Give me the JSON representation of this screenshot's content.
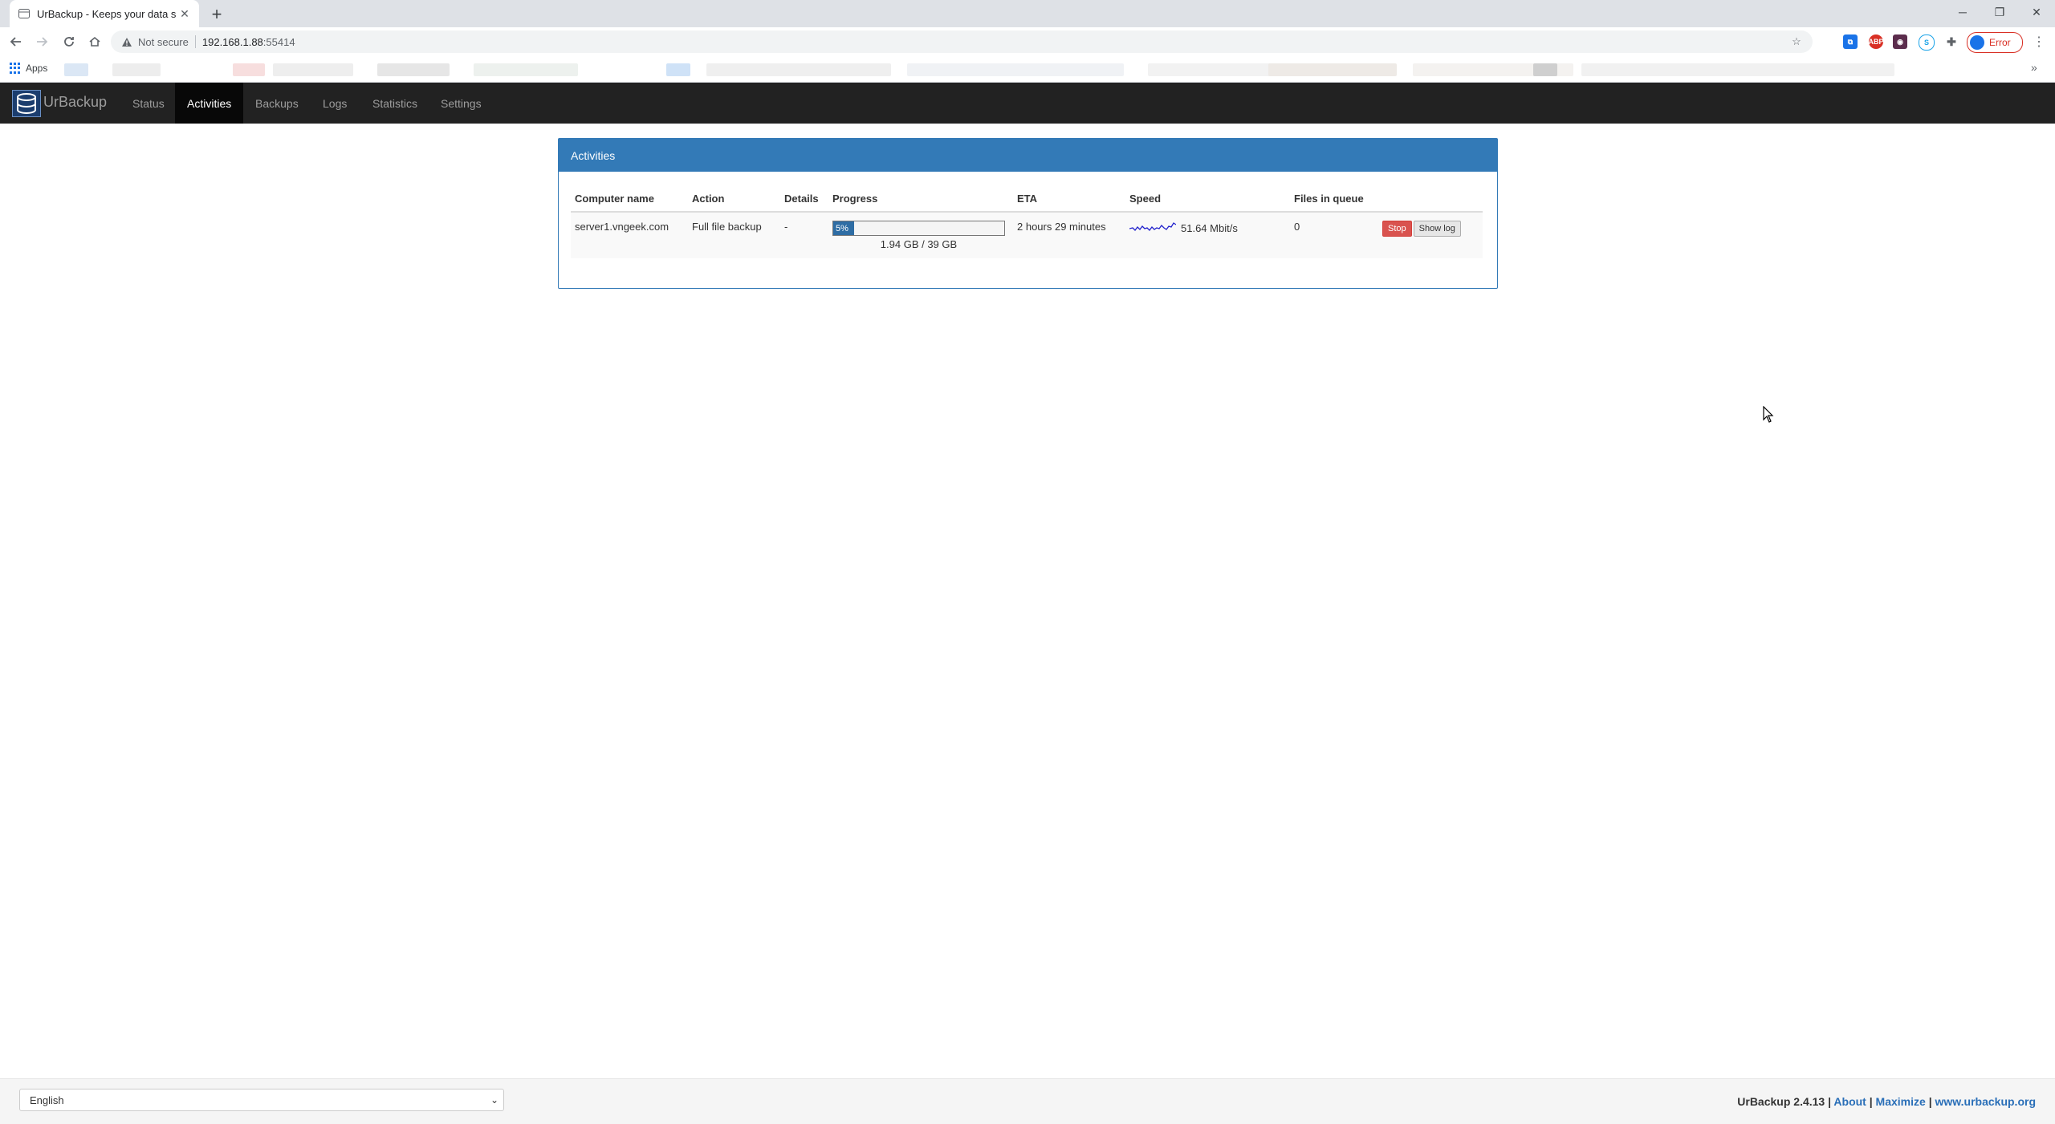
{
  "browser": {
    "tab_title": "UrBackup - Keeps your data safe",
    "new_tab_label": "+",
    "not_secure_label": "Not secure",
    "url_host": "192.168.1.88",
    "url_port": ":55414",
    "profile_label": "Error",
    "bookmarks_apps_label": "Apps"
  },
  "app": {
    "brand": "UrBackup",
    "nav": [
      {
        "label": "Status",
        "active": false
      },
      {
        "label": "Activities",
        "active": true
      },
      {
        "label": "Backups",
        "active": false
      },
      {
        "label": "Logs",
        "active": false
      },
      {
        "label": "Statistics",
        "active": false
      },
      {
        "label": "Settings",
        "active": false
      }
    ]
  },
  "activities": {
    "title": "Activities",
    "columns": [
      "Computer name",
      "Action",
      "Details",
      "Progress",
      "ETA",
      "Speed",
      "Files in queue"
    ],
    "rows": [
      {
        "computer_name": "server1.vngeek.com",
        "action": "Full file backup",
        "details": "-",
        "progress_percent": 5,
        "progress_label": "5%",
        "progress_size": "1.94 GB / 39 GB",
        "eta": "2 hours 29 minutes",
        "speed": "51.64 Mbit/s",
        "files_in_queue": "0",
        "stop_label": "Stop",
        "show_log_label": "Show log"
      }
    ]
  },
  "footer": {
    "language": "English",
    "version": "UrBackup 2.4.13",
    "sep": "|",
    "about": "About",
    "maximize": "Maximize",
    "website": "www.urbackup.org"
  },
  "colors": {
    "navbar_bg": "#222222",
    "panel_primary": "#337ab7",
    "stop_button": "#d9534f",
    "progress_fill": "#2e6da4"
  }
}
